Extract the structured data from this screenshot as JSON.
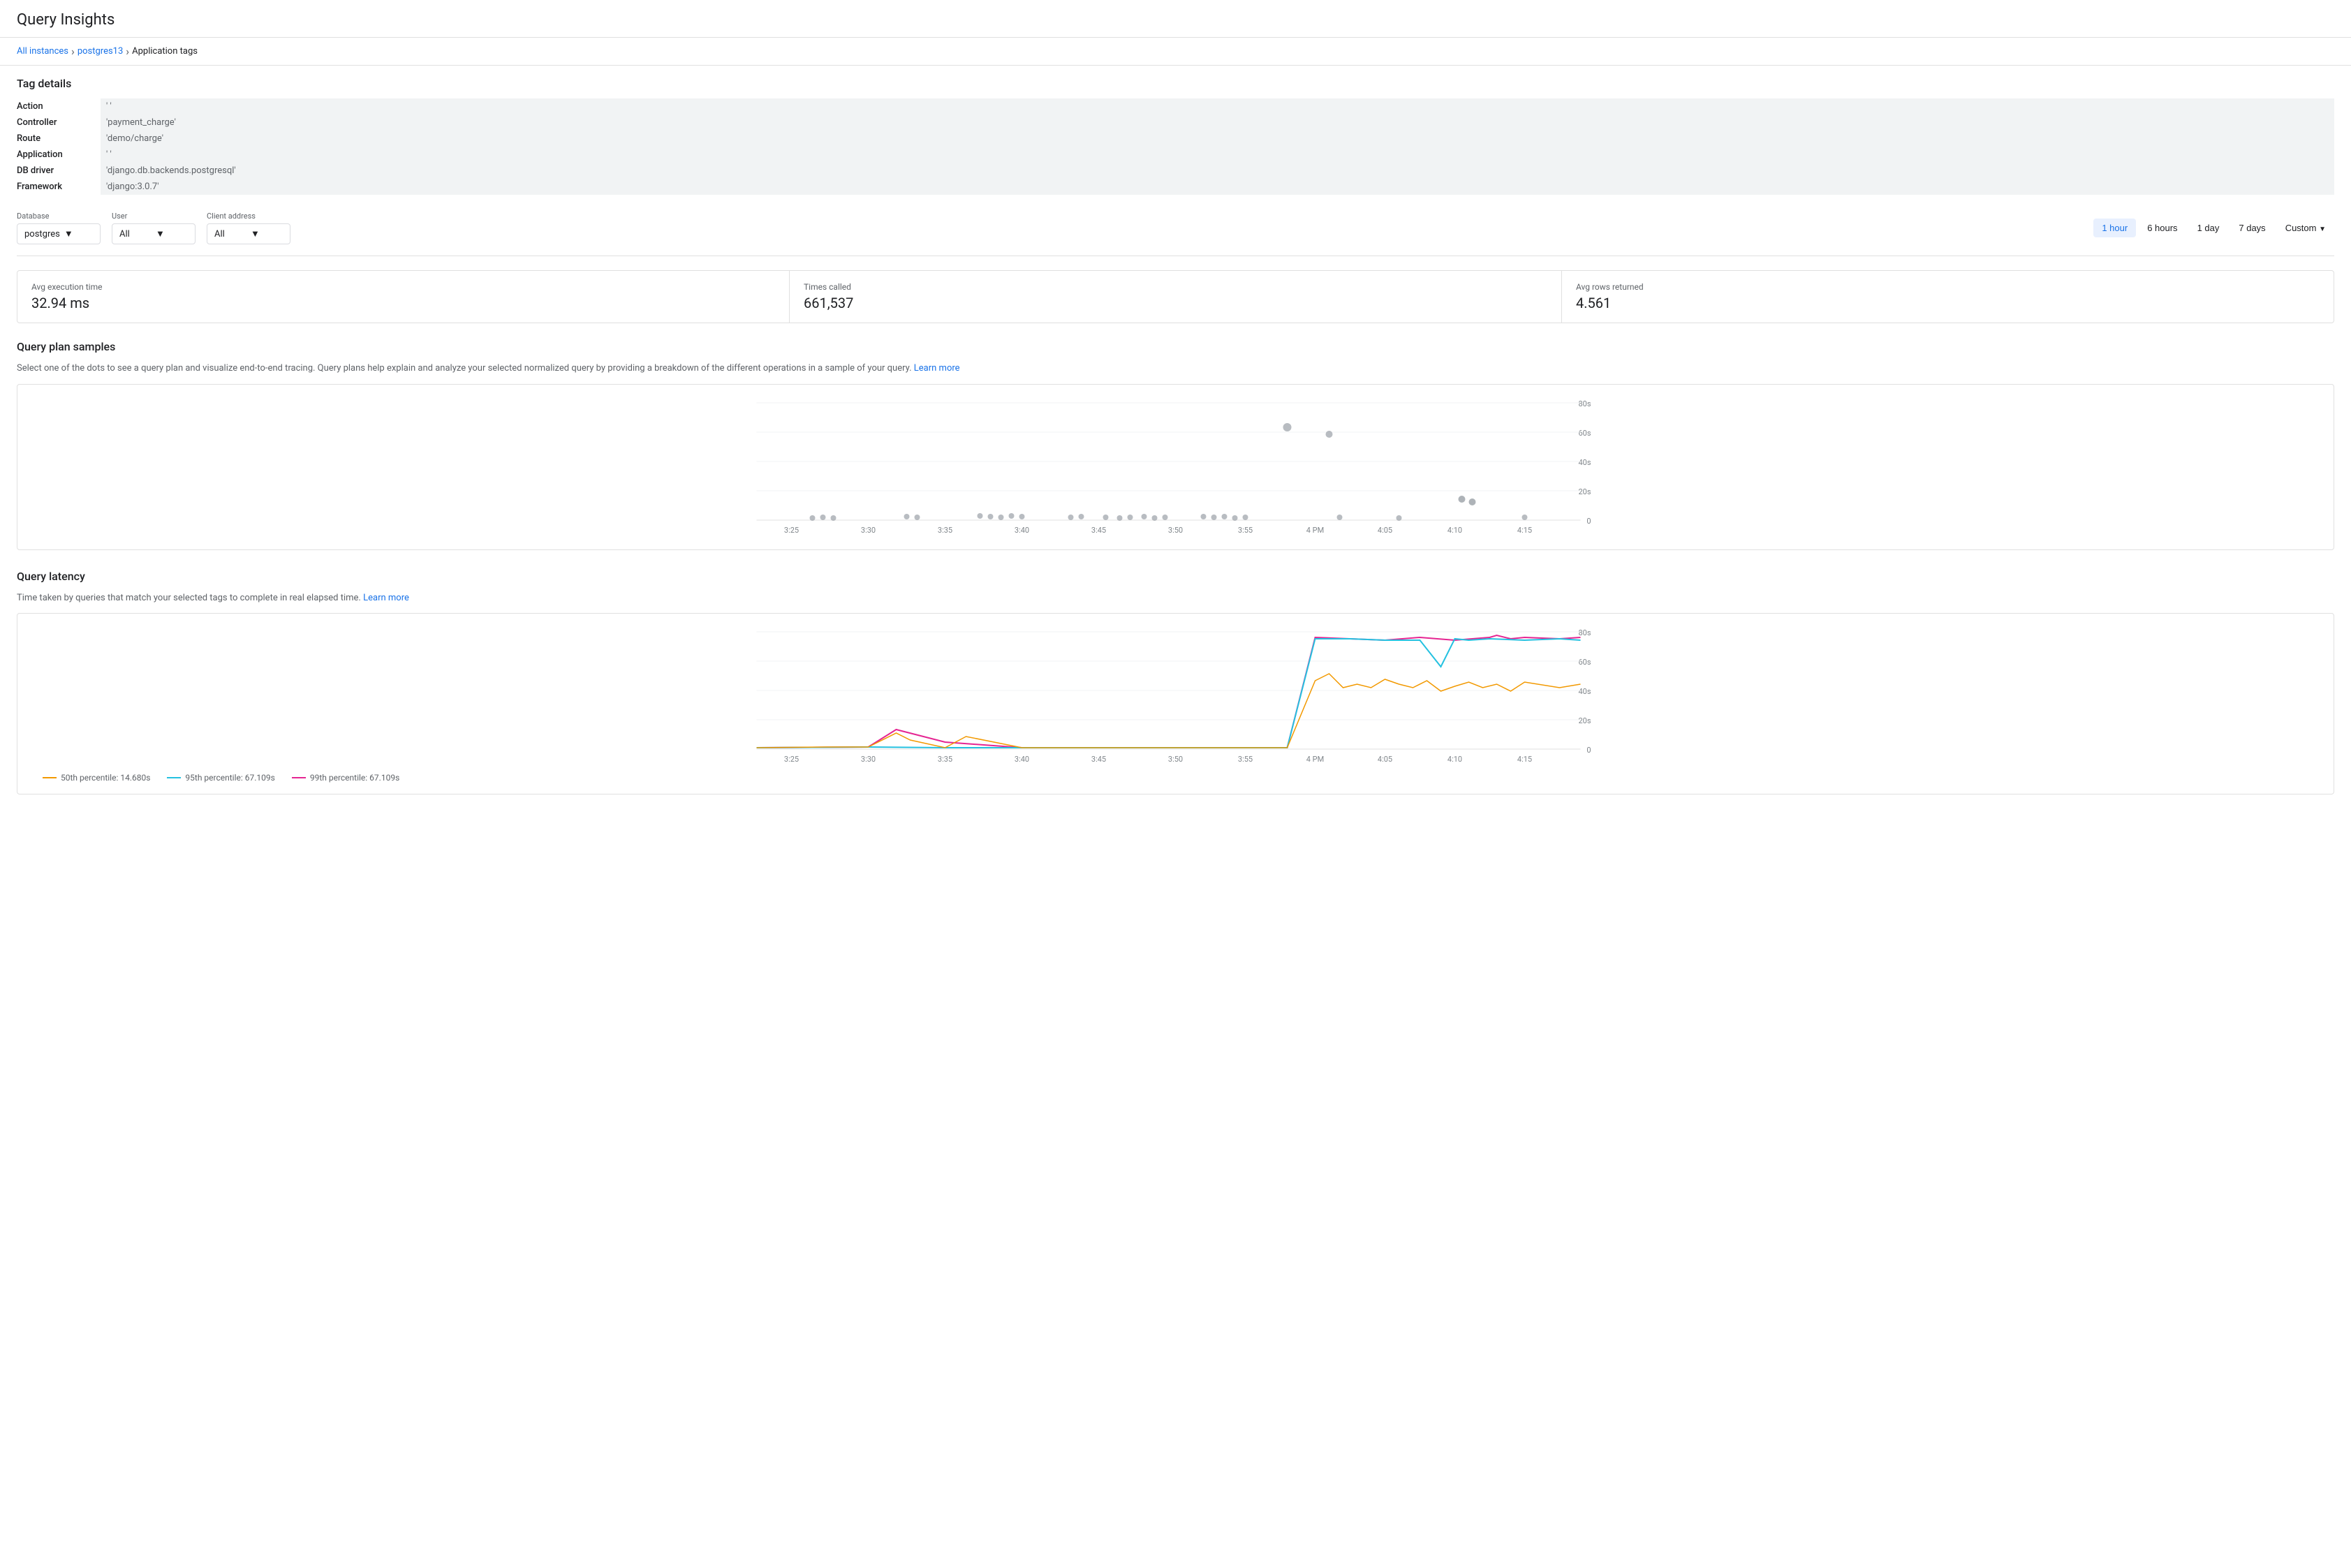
{
  "page": {
    "title": "Query Insights"
  },
  "breadcrumb": {
    "items": [
      {
        "label": "All instances",
        "link": true
      },
      {
        "label": "postgres13",
        "link": true
      },
      {
        "label": "Application tags",
        "link": false
      }
    ]
  },
  "tag_details": {
    "section_title": "Tag details",
    "rows": [
      {
        "label": "Action",
        "value": "' '"
      },
      {
        "label": "Controller",
        "value": "'payment_charge'"
      },
      {
        "label": "Route",
        "value": "'demo/charge'"
      },
      {
        "label": "Application",
        "value": "' '"
      },
      {
        "label": "DB driver",
        "value": "'django.db.backends.postgresql'"
      },
      {
        "label": "Framework",
        "value": "'django:3.0.7'"
      }
    ]
  },
  "filters": {
    "database": {
      "label": "Database",
      "value": "postgres",
      "options": [
        "postgres"
      ]
    },
    "user": {
      "label": "User",
      "value": "All",
      "options": [
        "All"
      ]
    },
    "client_address": {
      "label": "Client address",
      "value": "All",
      "options": [
        "All"
      ]
    }
  },
  "time_buttons": {
    "items": [
      "1 hour",
      "6 hours",
      "1 day",
      "7 days",
      "Custom"
    ],
    "active": "1 hour"
  },
  "metrics": [
    {
      "label": "Avg execution time",
      "value": "32.94 ms"
    },
    {
      "label": "Times called",
      "value": "661,537"
    },
    {
      "label": "Avg rows returned",
      "value": "4.561"
    }
  ],
  "query_plan": {
    "title": "Query plan samples",
    "description": "Select one of the dots to see a query plan and visualize end-to-end tracing. Query plans help explain and analyze your selected normalized query by providing a breakdown of the different operations in a sample of your query.",
    "learn_more": "Learn more",
    "x_labels": [
      "3:25",
      "3:30",
      "3:35",
      "3:40",
      "3:45",
      "3:50",
      "3:55",
      "4 PM",
      "4:05",
      "4:10",
      "4:15"
    ],
    "y_labels": [
      "80s",
      "60s",
      "40s",
      "20s",
      "0"
    ]
  },
  "query_latency": {
    "title": "Query latency",
    "description": "Time taken by queries that match your selected tags to complete in real elapsed time.",
    "learn_more": "Learn more",
    "x_labels": [
      "3:25",
      "3:30",
      "3:35",
      "3:40",
      "3:45",
      "3:50",
      "3:55",
      "4 PM",
      "4:05",
      "4:10",
      "4:15"
    ],
    "y_labels": [
      "80s",
      "60s",
      "40s",
      "20s",
      "0"
    ],
    "legend": [
      {
        "label": "50th percentile: 14.680s",
        "color": "#f29900",
        "type": "line"
      },
      {
        "label": "95th percentile: 67.109s",
        "color": "#24c1e0",
        "type": "line"
      },
      {
        "label": "99th percentile: 67.109s",
        "color": "#e52592",
        "type": "line"
      }
    ]
  },
  "colors": {
    "accent": "#1a73e8",
    "dot": "#9aa0a6",
    "p50": "#f29900",
    "p95": "#24c1e0",
    "p99": "#e52592",
    "grid": "#f1f3f4"
  }
}
